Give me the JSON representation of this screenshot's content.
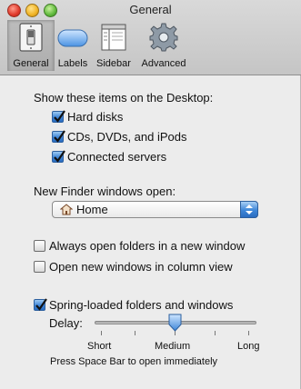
{
  "window": {
    "title": "General"
  },
  "toolbar": {
    "items": [
      {
        "label": "General",
        "icon": "light-switch-icon",
        "selected": true
      },
      {
        "label": "Labels",
        "icon": "label-pill-icon",
        "selected": false
      },
      {
        "label": "Sidebar",
        "icon": "sidebar-window-icon",
        "selected": false
      },
      {
        "label": "Advanced",
        "icon": "gear-icon",
        "selected": false
      }
    ]
  },
  "desktop": {
    "heading": "Show these items on the Desktop:",
    "options": [
      {
        "label": "Hard disks",
        "checked": true
      },
      {
        "label": "CDs, DVDs, and iPods",
        "checked": true
      },
      {
        "label": "Connected servers",
        "checked": true
      }
    ]
  },
  "new_window": {
    "label": "New Finder windows open:",
    "selected": "Home",
    "icon": "home-icon"
  },
  "folders": {
    "always_new_window": {
      "label": "Always open folders in a new window",
      "checked": false
    },
    "column_view": {
      "label": "Open new windows in column view",
      "checked": false
    }
  },
  "spring": {
    "label": "Spring-loaded folders and windows",
    "checked": true,
    "delay_label": "Delay:",
    "ticks": [
      "Short",
      "Medium",
      "Long"
    ],
    "value": 0.5,
    "hint": "Press Space Bar to open immediately"
  },
  "colors": {
    "accent": "#3d86d8",
    "background": "#ececec"
  }
}
